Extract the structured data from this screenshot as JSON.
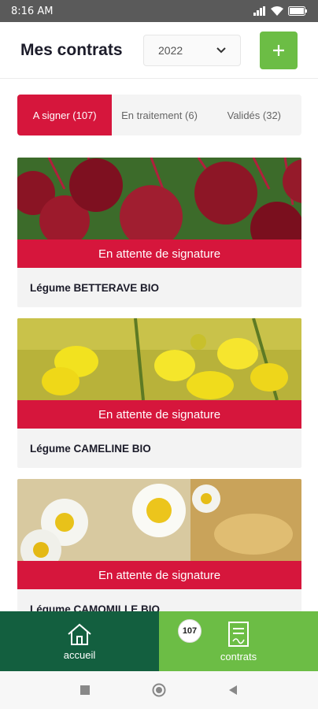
{
  "statusbar": {
    "time": "8:16 AM"
  },
  "header": {
    "title": "Mes contrats",
    "year": "2022",
    "add_label": "+"
  },
  "tabs": [
    {
      "label": "A signer (107)",
      "active": true
    },
    {
      "label": "En traitement (6)",
      "active": false
    },
    {
      "label": "Validés (32)",
      "active": false
    }
  ],
  "cards": [
    {
      "status": "En attente de signature",
      "name": "Légume BETTERAVE BIO",
      "image": "beetroot"
    },
    {
      "status": "En attente de signature",
      "name": "Légume CAMELINE BIO",
      "image": "yellow-flowers"
    },
    {
      "status": "En attente de signature",
      "name": "Légume CAMOMILLE BIO",
      "image": "chamomile"
    }
  ],
  "bottomnav": {
    "home_label": "accueil",
    "contracts_label": "contrats",
    "badge": "107"
  },
  "colors": {
    "accent_red": "#d6163c",
    "green": "#6cbd45",
    "dark_green": "#135f3f"
  }
}
